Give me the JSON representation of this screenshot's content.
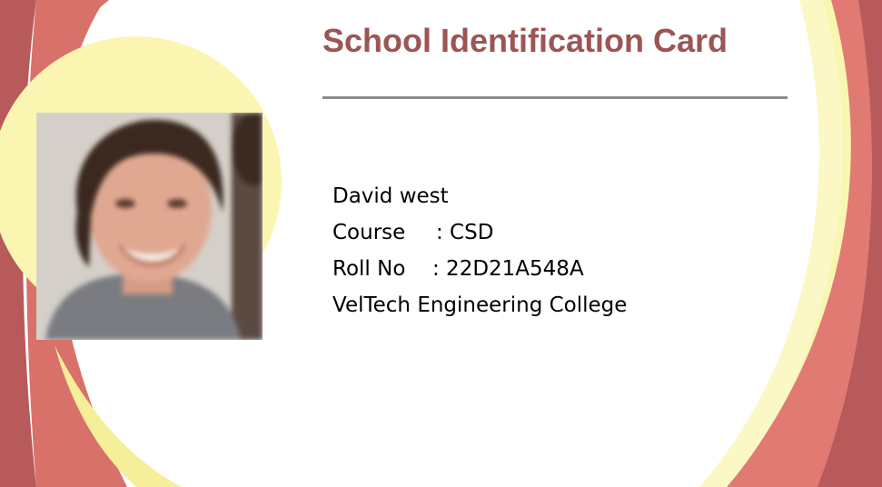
{
  "card": {
    "title": "School Identification Card",
    "name": "David west",
    "course_label": "Course",
    "course_value": ": CSD",
    "roll_label": "Roll No",
    "roll_value": ": 22D21A548A",
    "college": "VelTech Engineering College"
  },
  "colors": {
    "background": "#ffffff",
    "title": "#9c5555",
    "rule": "#8c8c8c",
    "dark_red": "#b85a5a",
    "coral": "#e07a72",
    "yellow": "#faf6b2"
  },
  "photo": {
    "description_icon": "person-photo-icon"
  }
}
